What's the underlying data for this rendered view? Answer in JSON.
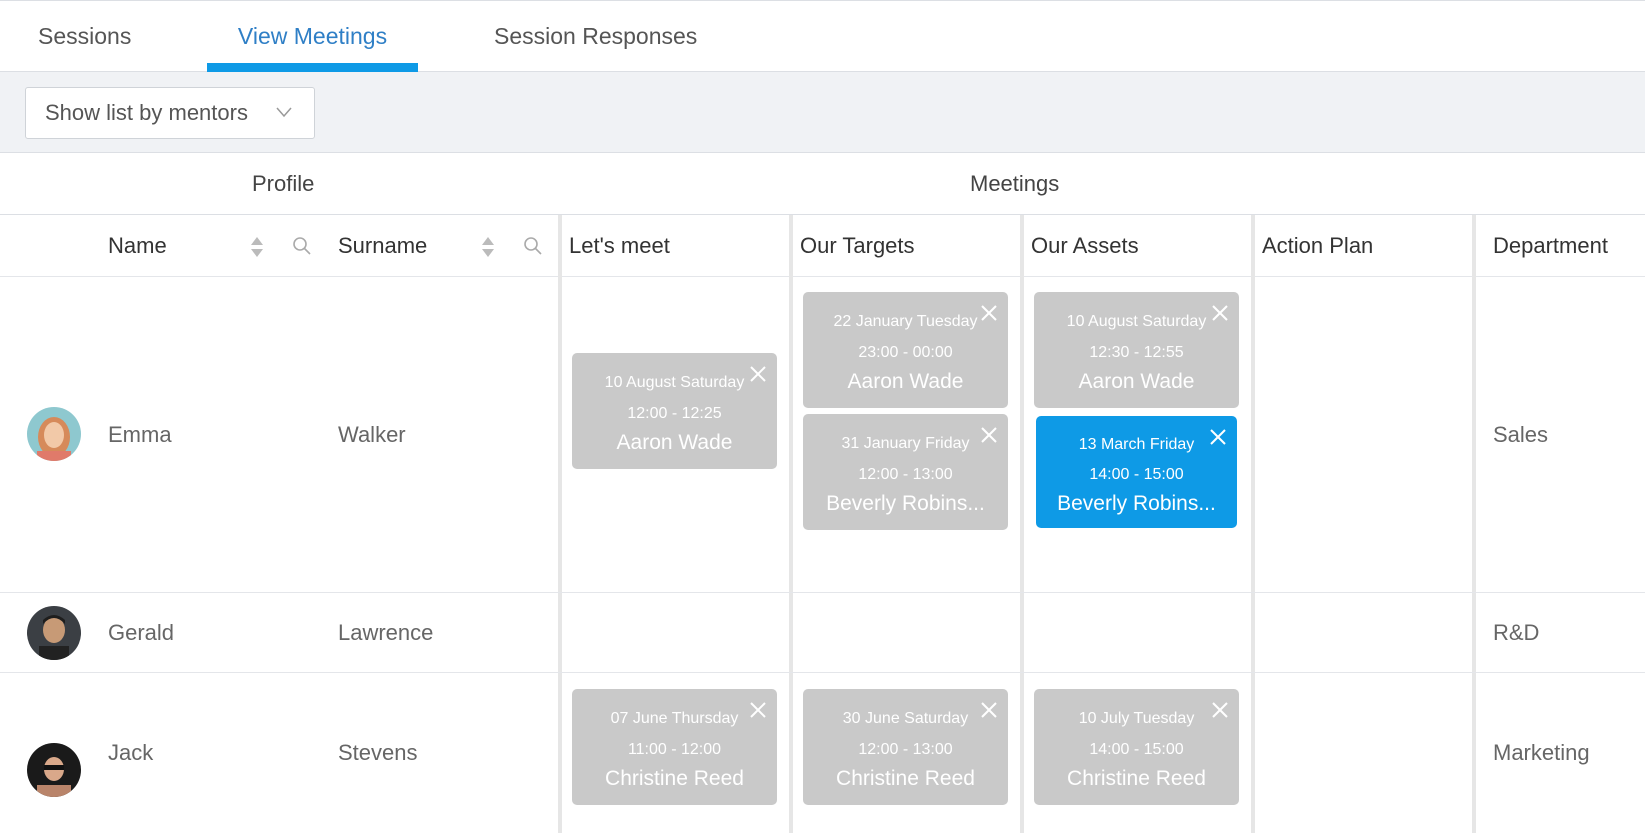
{
  "tabs": [
    {
      "label": "Sessions",
      "active": false
    },
    {
      "label": "View Meetings",
      "active": true
    },
    {
      "label": "Session Responses",
      "active": false
    }
  ],
  "filter": {
    "dropdown_label": "Show list by mentors",
    "icon": "chevron-down-icon"
  },
  "groups": {
    "profile": "Profile",
    "meetings": "Meetings"
  },
  "columns": {
    "name": "Name",
    "surname": "Surname",
    "lets_meet": "Let's meet",
    "our_targets": "Our Targets",
    "our_assets": "Our Assets",
    "action_plan": "Action Plan",
    "department": "Department"
  },
  "colors": {
    "accent": "#0e9ae6",
    "tab_active_text": "#2f7fc6",
    "card_default": "#c9c9c9"
  },
  "rows": [
    {
      "name": "Emma",
      "surname": "Walker",
      "department": "Sales",
      "lets_meet": [
        {
          "date": "10 August Saturday",
          "time": "12:00 - 12:25",
          "person": "Aaron Wade"
        }
      ],
      "our_targets": [
        {
          "date": "22 January Tuesday",
          "time": "23:00 - 00:00",
          "person": "Aaron Wade"
        },
        {
          "date": "31 January Friday",
          "time": "12:00 - 13:00",
          "person": "Beverly Robins..."
        }
      ],
      "our_assets": [
        {
          "date": "10 August Saturday",
          "time": "12:30 - 12:55",
          "person": "Aaron Wade"
        },
        {
          "date": "13 March Friday",
          "time": "14:00 - 15:00",
          "person": "Beverly Robins...",
          "selected": true
        }
      ]
    },
    {
      "name": "Gerald",
      "surname": "Lawrence",
      "department": "R&D",
      "lets_meet": [],
      "our_targets": [],
      "our_assets": []
    },
    {
      "name": "Jack",
      "surname": "Stevens",
      "department": "Marketing",
      "lets_meet": [
        {
          "date": "07 June Thursday",
          "time": "11:00 - 12:00",
          "person": "Christine Reed"
        }
      ],
      "our_targets": [
        {
          "date": "30 June Saturday",
          "time": "12:00 - 13:00",
          "person": "Christine Reed"
        }
      ],
      "our_assets": [
        {
          "date": "10 July Tuesday",
          "time": "14:00 - 15:00",
          "person": "Christine Reed"
        }
      ]
    }
  ]
}
